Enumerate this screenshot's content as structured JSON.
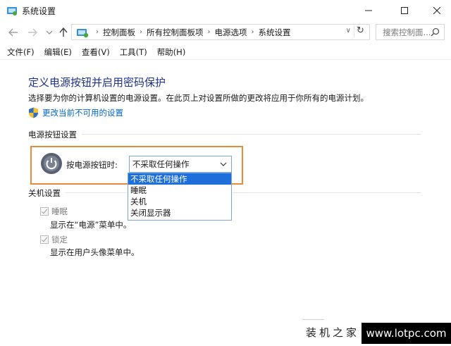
{
  "window": {
    "title": "系统设置"
  },
  "address_bar": {
    "breadcrumbs": [
      "控制面板",
      "所有控制面板项",
      "电源选项",
      "系统设置"
    ],
    "search_placeholder": "搜索控制面..."
  },
  "menu": {
    "items": [
      "文件(F)",
      "编辑(E)",
      "查看(V)",
      "工具(T)",
      "帮助(H)"
    ]
  },
  "content": {
    "heading": "定义电源按钮并启用密码保护",
    "description": "选择要为你的计算机设置的电源设置。在此页上对设置所做的更改将应用于你所有的电源计划。",
    "change_link": "更改当前不可用的设置",
    "power_group_label": "电源按钮设置",
    "power_button_label": "按电源按钮时:",
    "power_button_value": "不采取任何操作",
    "dropdown_options": [
      "不采取任何操作",
      "睡眠",
      "关机",
      "关闭显示器"
    ],
    "dropdown_selected_index": 0,
    "shutdown_group_label": "关机设置",
    "sleep_label": "睡眠",
    "sleep_desc": "显示在“电源”菜单中。",
    "lock_label": "锁定",
    "lock_desc": "显示在用户头像菜单中。"
  },
  "watermark": {
    "text": "装机之家",
    "url": "www.lotpc.com"
  },
  "colors": {
    "heading": "#1e3287",
    "link": "#0066cc",
    "highlight_border": "#e88c3c",
    "selected_option": "#1e6fd9"
  }
}
